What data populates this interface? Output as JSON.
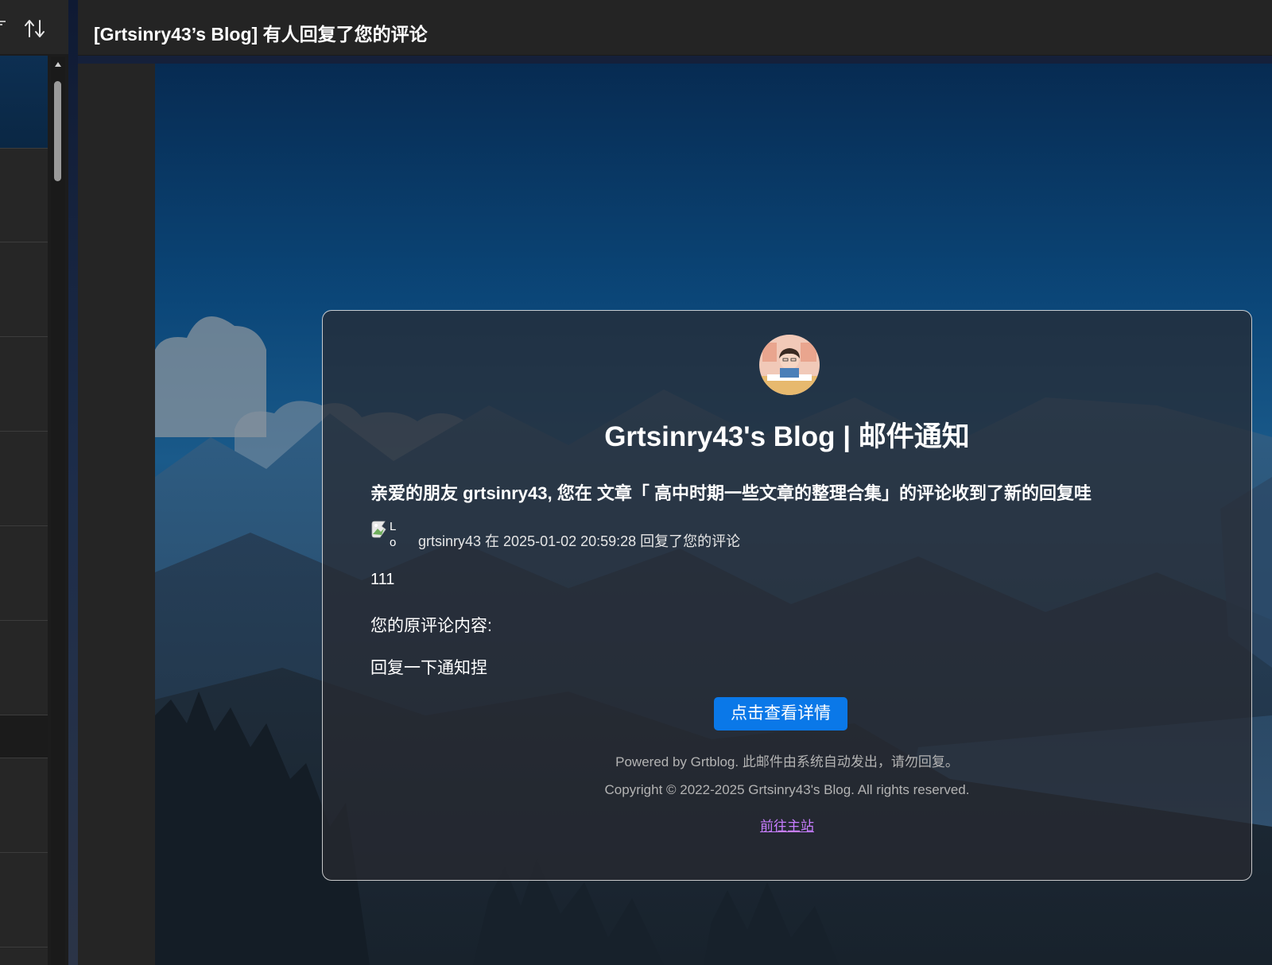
{
  "window": {
    "subject": "[Grtsinry43’s Blog] 有人回复了您的评论"
  },
  "list_toolbar": {
    "filter_icon": "filter-icon",
    "sort_icon": "sort-arrows-icon"
  },
  "email": {
    "title": "Grtsinry43's Blog | 邮件通知",
    "greeting": "亲爱的朋友 grtsinry43, 您在 文章「 高中时期一些文章的整理合集」的评论收到了新的回复哇",
    "avatar_alt": "Lo",
    "reply_meta": "grtsinry43 在 2025-01-02 20:59:28 回复了您的评论",
    "reply_content": "111",
    "original_label": "您的原评论内容:",
    "original_content": "回复一下通知捏",
    "button_label": "点击查看详情",
    "footer_powered": "Powered by Grtblog. 此邮件由系统自动发出，请勿回复。",
    "footer_copyright": "Copyright © 2022-2025 Grtsinry43's Blog. All rights reserved.",
    "footer_link": "前往主站"
  },
  "colors": {
    "button": "#0a78e8",
    "link": "#c77dff",
    "selected_item": "#0d2f52"
  }
}
